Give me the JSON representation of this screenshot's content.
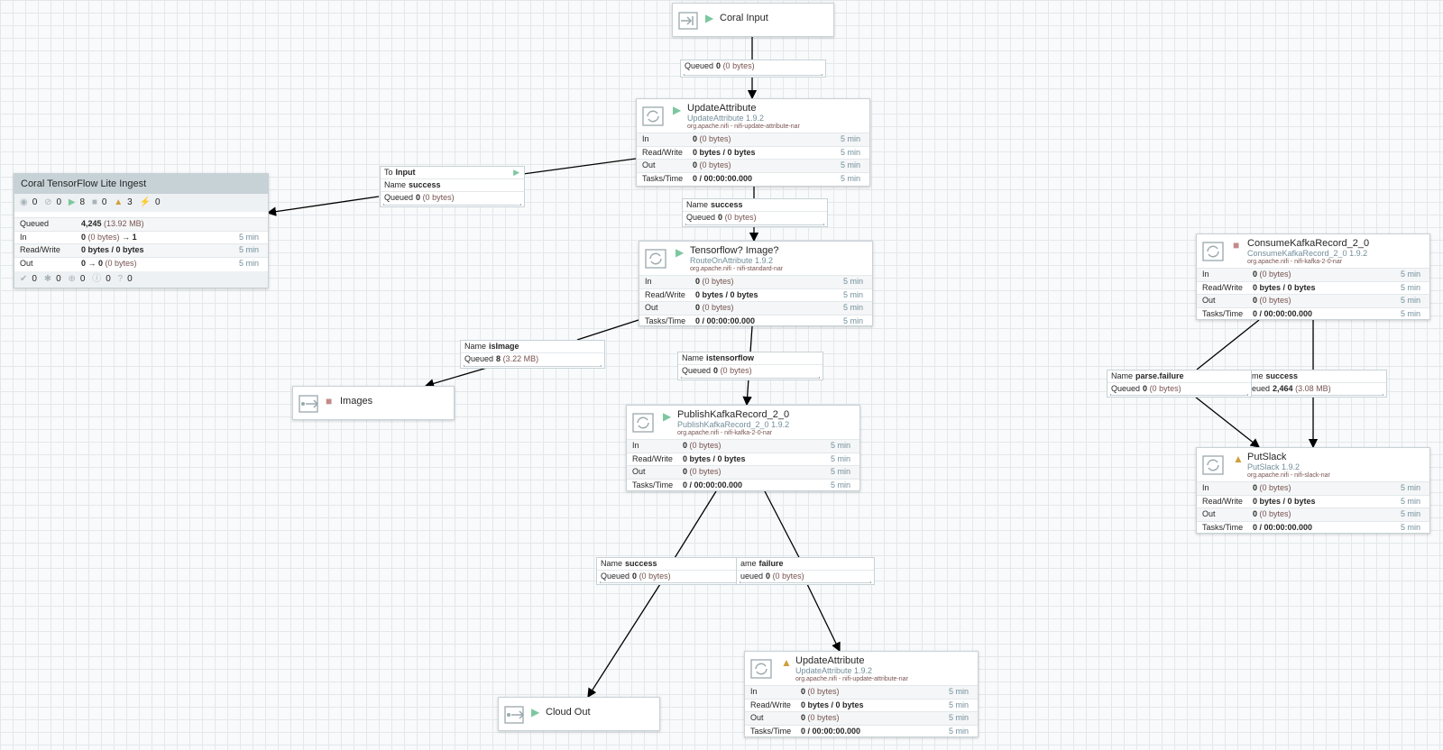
{
  "process_group": {
    "name": "Coral TensorFlow Lite Ingest",
    "stats": {
      "transmitting": "0",
      "not_transmitting": "0",
      "running": "8",
      "stopped": "0",
      "invalid": "3",
      "disabled": "0"
    },
    "queued_label": "Queued",
    "queued_value": "4,245",
    "queued_size": "(13.92 MB)",
    "in_label": "In",
    "in_value": "0",
    "in_size": "(0 bytes)",
    "in_arrow": "→ 1",
    "in_time": "5 min",
    "rw_label": "Read/Write",
    "rw_value": "0 bytes / 0 bytes",
    "rw_time": "5 min",
    "out_label": "Out",
    "out_value": "0 → 0",
    "out_size": "(0 bytes)",
    "out_time": "5 min",
    "versions": {
      "up_to_date": "0",
      "locally_modified": "0",
      "stale": "0",
      "modified_stale": "0",
      "sync_failure": "0"
    }
  },
  "ports": {
    "coral_input": {
      "name": "Coral Input",
      "type": "input-port",
      "status": "running"
    },
    "images": {
      "name": "Images",
      "type": "output-port",
      "status": "stopped"
    },
    "cloud_out": {
      "name": "Cloud Out",
      "type": "output-port",
      "status": "running"
    }
  },
  "processors": {
    "update_attribute_1": {
      "name": "UpdateAttribute",
      "type": "UpdateAttribute 1.9.2",
      "bundle": "org.apache.nifi - nifi-update-attribute-nar",
      "status": "running",
      "in": "0",
      "in_size": "(0 bytes)",
      "rw": "0 bytes / 0 bytes",
      "out": "0",
      "out_size": "(0 bytes)",
      "tasks": "0 / 00:00:00.000",
      "time": "5 min"
    },
    "route_on_attribute": {
      "name": "Tensorflow? Image?",
      "type": "RouteOnAttribute 1.9.2",
      "bundle": "org.apache.nifi - nifi-standard-nar",
      "status": "running",
      "in": "0",
      "in_size": "(0 bytes)",
      "rw": "0 bytes / 0 bytes",
      "out": "0",
      "out_size": "(0 bytes)",
      "tasks": "0 / 00:00:00.000",
      "time": "5 min"
    },
    "publish_kafka": {
      "name": "PublishKafkaRecord_2_0",
      "type": "PublishKafkaRecord_2_0 1.9.2",
      "bundle": "org.apache.nifi - nifi-kafka-2-0-nar",
      "status": "running",
      "in": "0",
      "in_size": "(0 bytes)",
      "rw": "0 bytes / 0 bytes",
      "out": "0",
      "out_size": "(0 bytes)",
      "tasks": "0 / 00:00:00.000",
      "time": "5 min"
    },
    "update_attribute_2": {
      "name": "UpdateAttribute",
      "type": "UpdateAttribute 1.9.2",
      "bundle": "org.apache.nifi - nifi-update-attribute-nar",
      "status": "invalid",
      "in": "0",
      "in_size": "(0 bytes)",
      "rw": "0 bytes / 0 bytes",
      "out": "0",
      "out_size": "(0 bytes)",
      "tasks": "0 / 00:00:00.000",
      "time": "5 min"
    },
    "consume_kafka": {
      "name": "ConsumeKafkaRecord_2_0",
      "type": "ConsumeKafkaRecord_2_0 1.9.2",
      "bundle": "org.apache.nifi - nifi-kafka-2-0-nar",
      "status": "stopped",
      "in": "0",
      "in_size": "(0 bytes)",
      "rw": "0 bytes / 0 bytes",
      "out": "0",
      "out_size": "(0 bytes)",
      "tasks": "0 / 00:00:00.000",
      "time": "5 min"
    },
    "put_slack": {
      "name": "PutSlack",
      "type": "PutSlack 1.9.2",
      "bundle": "org.apache.nifi - nifi-slack-nar",
      "status": "invalid",
      "in": "0",
      "in_size": "(0 bytes)",
      "rw": "0 bytes / 0 bytes",
      "out": "0",
      "out_size": "(0 bytes)",
      "tasks": "0 / 00:00:00.000",
      "time": "5 min"
    }
  },
  "labels": {
    "in": "In",
    "rw": "Read/Write",
    "out": "Out",
    "tasks": "Tasks/Time",
    "name": "Name",
    "queued": "Queued",
    "to": "To"
  },
  "connections": {
    "c1": {
      "queued": "0",
      "size": "(0 bytes)"
    },
    "c2": {
      "to": "Input",
      "name": "success",
      "queued": "0",
      "size": "(0 bytes)"
    },
    "c3": {
      "name": "success",
      "queued": "0",
      "size": "(0 bytes)"
    },
    "c4": {
      "name": "isImage",
      "queued": "8",
      "size": "(3.22 MB)"
    },
    "c5": {
      "name": "istensorflow",
      "queued": "0",
      "size": "(0 bytes)"
    },
    "c6": {
      "name": "success",
      "queued": "0",
      "size": "(0 bytes)"
    },
    "c7": {
      "name_partial": "ame",
      "name": "failure",
      "queued_partial": "ueued",
      "queued": "0",
      "size": "(0 bytes)"
    },
    "c8": {
      "name": "parse.failure",
      "queued": "0",
      "size": "(0 bytes)"
    },
    "c9": {
      "name_partial": "ame",
      "name": "success",
      "queued_partial": "ueued",
      "queued": "2,464",
      "size": "(3.08 MB)"
    }
  },
  "icon_names": [
    "input-port-icon",
    "output-port-icon",
    "processor-icon",
    "running-icon",
    "stopped-icon",
    "warning-icon"
  ]
}
